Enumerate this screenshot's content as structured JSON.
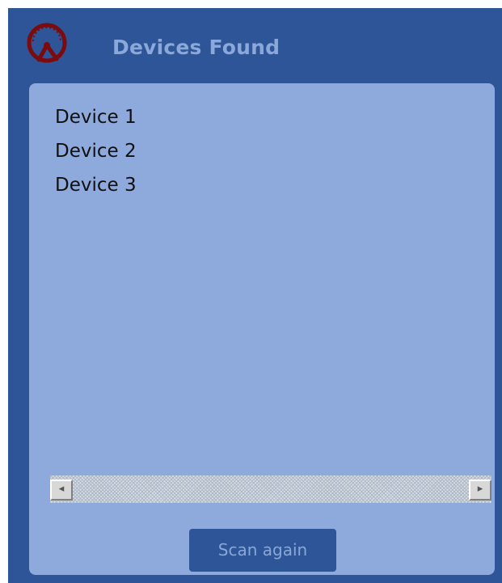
{
  "header": {
    "title": "Devices Found",
    "icon": "speedometer-icon"
  },
  "devices": {
    "items": [
      "Device 1",
      "Device 2",
      "Device 3"
    ]
  },
  "scrollbar": {
    "left_arrow": "◂",
    "right_arrow": "▸"
  },
  "actions": {
    "scan_again_label": "Scan again"
  },
  "colors": {
    "window_bg": "#2e5597",
    "panel_bg": "#8eaadd",
    "title_text": "#8aa8d9",
    "icon_red": "#7a0b0f"
  }
}
